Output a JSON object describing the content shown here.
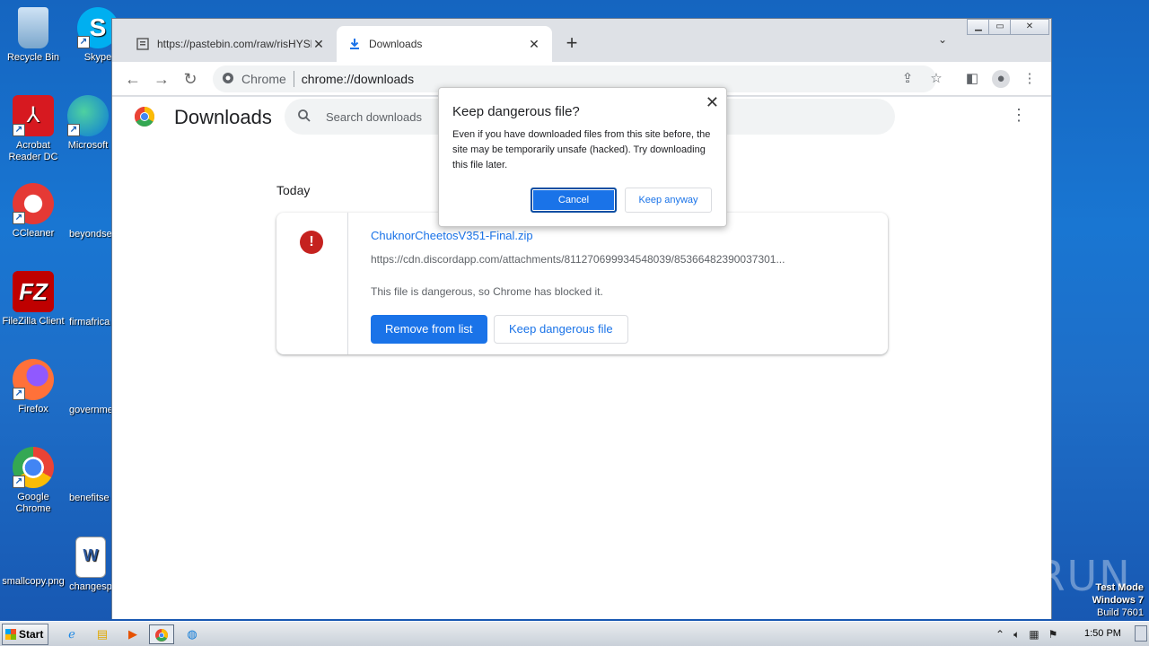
{
  "desktop": {
    "icons": [
      {
        "label": "Recycle Bin"
      },
      {
        "label": "Skype"
      },
      {
        "label": "Acrobat Reader DC"
      },
      {
        "label": "Microsoft"
      },
      {
        "label": "CCleaner"
      },
      {
        "label": "beyondse"
      },
      {
        "label": "FileZilla Client"
      },
      {
        "label": "firmafrica"
      },
      {
        "label": "Firefox"
      },
      {
        "label": "governme"
      },
      {
        "label": "Google Chrome"
      },
      {
        "label": "benefitse"
      },
      {
        "label": "smallcopy.png"
      },
      {
        "label": "changesp"
      }
    ],
    "watermark": "ANY RUN",
    "test_mode": {
      "line1": "Test Mode",
      "line2": "Windows 7",
      "line3": "Build 7601"
    }
  },
  "browser": {
    "tabs": [
      {
        "title": "https://pastebin.com/raw/risHYShF",
        "icon": "pastebin-icon",
        "active": false
      },
      {
        "title": "Downloads",
        "icon": "download-icon",
        "active": true
      }
    ],
    "address_bar": {
      "chip": "Chrome",
      "url": "chrome://downloads"
    }
  },
  "downloads_page": {
    "title": "Downloads",
    "search_placeholder": "Search downloads",
    "section": "Today",
    "item": {
      "file_name": "ChuknorCheetosV351-Final.zip",
      "url": "https://cdn.discordapp.com/attachments/811270699934548039/85366482390037301...",
      "status": "This file is dangerous, so Chrome has blocked it.",
      "remove_label": "Remove from list",
      "keep_label": "Keep dangerous file"
    }
  },
  "dialog": {
    "title": "Keep dangerous file?",
    "body": "Even if you have downloaded files from this site before, the site may be temporarily unsafe (hacked). Try downloading this file later.",
    "cancel_label": "Cancel",
    "keep_label": "Keep anyway"
  },
  "taskbar": {
    "start_label": "Start",
    "clock": "1:50 PM"
  },
  "colors": {
    "accent": "#1a73e8",
    "danger": "#c5221f",
    "desktop": "#1976d2"
  }
}
